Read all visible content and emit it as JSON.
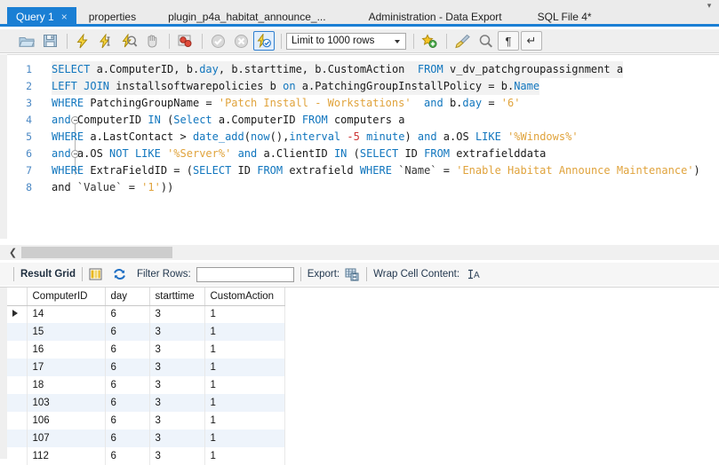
{
  "window": {
    "app": "MySQL Workbench SQL Editor"
  },
  "tabs": {
    "items": [
      {
        "label": "Query 1",
        "active": true,
        "closable": true
      },
      {
        "label": "properties",
        "active": false,
        "closable": false
      },
      {
        "label": "plugin_p4a_habitat_announce_...",
        "active": false,
        "closable": false
      },
      {
        "label": "Administration - Data Export",
        "active": false,
        "closable": false
      },
      {
        "label": "SQL File 4*",
        "active": false,
        "closable": false
      }
    ],
    "close_glyph": "×",
    "overflow_glyph": "▾",
    "accent_color": "#1a7fd4"
  },
  "toolbar": {
    "buttons": [
      {
        "name": "open-sql-script-icon",
        "glyph": "folder"
      },
      {
        "name": "save-sql-script-icon",
        "glyph": "floppy"
      },
      {
        "name": "execute-statement-icon",
        "glyph": "bolt"
      },
      {
        "name": "execute-current-statement-icon",
        "glyph": "bolt-cursor"
      },
      {
        "name": "explain-statement-icon",
        "glyph": "bolt-magnifier"
      },
      {
        "name": "stop-script-icon",
        "glyph": "hand"
      },
      {
        "name": "toggle-stop-on-error-icon",
        "glyph": "stop-error"
      },
      {
        "name": "commit-icon",
        "glyph": "check"
      },
      {
        "name": "rollback-icon",
        "glyph": "cross"
      },
      {
        "name": "autocommit-icon",
        "glyph": "bolt-check"
      }
    ],
    "limit_label": "Limit to 1000 rows",
    "right_buttons": [
      {
        "name": "add-snippet-icon",
        "glyph": "star-plus"
      },
      {
        "name": "beautify-query-icon",
        "glyph": "broom"
      },
      {
        "name": "find-icon",
        "glyph": "magnifier"
      },
      {
        "name": "toggle-invisible-chars-icon",
        "glyph": "¶"
      },
      {
        "name": "toggle-word-wrap-icon",
        "glyph": "↵"
      }
    ]
  },
  "editor": {
    "lines": [
      {
        "number": "1",
        "highlight": true,
        "fold": "none",
        "tokens": [
          {
            "t": "SELECT",
            "c": "kw"
          },
          {
            "t": " a.ComputerID, b.",
            "c": ""
          },
          {
            "t": "day",
            "c": "kw"
          },
          {
            "t": ", b.starttime, b.CustomAction  ",
            "c": ""
          },
          {
            "t": "FROM",
            "c": "kw"
          },
          {
            "t": " v_dv_patchgroupassignment a",
            "c": ""
          }
        ]
      },
      {
        "number": "2",
        "highlight": true,
        "fold": "none",
        "tokens": [
          {
            "t": "LEFT JOIN",
            "c": "kw"
          },
          {
            "t": " installsoftwarepolicies b ",
            "c": ""
          },
          {
            "t": "on",
            "c": "kw"
          },
          {
            "t": " a.PatchingGroupInstallPolicy = b.",
            "c": ""
          },
          {
            "t": "Name",
            "c": "kw"
          }
        ]
      },
      {
        "number": "3",
        "highlight": false,
        "fold": "none",
        "tokens": [
          {
            "t": "WHERE",
            "c": "kw"
          },
          {
            "t": " PatchingGroupName = ",
            "c": ""
          },
          {
            "t": "'Patch Install - Workstations'",
            "c": "str"
          },
          {
            "t": "  ",
            "c": ""
          },
          {
            "t": "and",
            "c": "kw"
          },
          {
            "t": " b.",
            "c": ""
          },
          {
            "t": "day",
            "c": "kw"
          },
          {
            "t": " = ",
            "c": ""
          },
          {
            "t": "'6'",
            "c": "str"
          }
        ]
      },
      {
        "number": "4",
        "highlight": false,
        "fold": "start",
        "tokens": [
          {
            "t": "and",
            "c": "kw"
          },
          {
            "t": " ComputerID ",
            "c": ""
          },
          {
            "t": "IN",
            "c": "kw"
          },
          {
            "t": " (",
            "c": ""
          },
          {
            "t": "Select",
            "c": "kw"
          },
          {
            "t": " a.ComputerID ",
            "c": ""
          },
          {
            "t": "FROM",
            "c": "kw"
          },
          {
            "t": " computers a",
            "c": ""
          }
        ]
      },
      {
        "number": "5",
        "highlight": false,
        "fold": "mid",
        "tokens": [
          {
            "t": "WHERE",
            "c": "kw"
          },
          {
            "t": " a.LastContact > ",
            "c": ""
          },
          {
            "t": "date_add",
            "c": "fn"
          },
          {
            "t": "(",
            "c": ""
          },
          {
            "t": "now",
            "c": "fn"
          },
          {
            "t": "(),",
            "c": ""
          },
          {
            "t": "interval",
            "c": "kw"
          },
          {
            "t": " ",
            "c": ""
          },
          {
            "t": "-5",
            "c": "num"
          },
          {
            "t": " ",
            "c": ""
          },
          {
            "t": "minute",
            "c": "kw"
          },
          {
            "t": ") ",
            "c": ""
          },
          {
            "t": "and",
            "c": "kw"
          },
          {
            "t": " a.OS ",
            "c": ""
          },
          {
            "t": "LIKE",
            "c": "kw"
          },
          {
            "t": " ",
            "c": ""
          },
          {
            "t": "'%Windows%'",
            "c": "str"
          }
        ]
      },
      {
        "number": "6",
        "highlight": false,
        "fold": "start",
        "tokens": [
          {
            "t": "and",
            "c": "kw"
          },
          {
            "t": " a.OS ",
            "c": ""
          },
          {
            "t": "NOT LIKE",
            "c": "kw"
          },
          {
            "t": " ",
            "c": ""
          },
          {
            "t": "'%Server%'",
            "c": "str"
          },
          {
            "t": " ",
            "c": ""
          },
          {
            "t": "and",
            "c": "kw"
          },
          {
            "t": " a.ClientID ",
            "c": ""
          },
          {
            "t": "IN",
            "c": "kw"
          },
          {
            "t": " (",
            "c": ""
          },
          {
            "t": "SELECT",
            "c": "kw"
          },
          {
            "t": " ID ",
            "c": ""
          },
          {
            "t": "FROM",
            "c": "kw"
          },
          {
            "t": " extrafielddata",
            "c": ""
          }
        ]
      },
      {
        "number": "7",
        "highlight": false,
        "fold": "end",
        "tokens": [
          {
            "t": "WHERE",
            "c": "kw"
          },
          {
            "t": " ExtraFieldID = (",
            "c": ""
          },
          {
            "t": "SELECT",
            "c": "kw"
          },
          {
            "t": " ID ",
            "c": ""
          },
          {
            "t": "FROM",
            "c": "kw"
          },
          {
            "t": " extrafield ",
            "c": ""
          },
          {
            "t": "WHERE",
            "c": "kw"
          },
          {
            "t": " ",
            "c": ""
          },
          {
            "t": "`Name`",
            "c": "tick"
          },
          {
            "t": " = ",
            "c": ""
          },
          {
            "t": "'Enable Habitat Announce Maintenance'",
            "c": "str"
          },
          {
            "t": ")",
            "c": ""
          }
        ]
      },
      {
        "number": "8",
        "highlight": false,
        "fold": "none",
        "tokens": [
          {
            "t": "and ",
            "c": ""
          },
          {
            "t": "`Value`",
            "c": "tick"
          },
          {
            "t": " = ",
            "c": ""
          },
          {
            "t": "'1'",
            "c": "str"
          },
          {
            "t": "))",
            "c": ""
          }
        ]
      }
    ]
  },
  "scrollbar": {
    "left_glyph": "❮"
  },
  "results_toolbar": {
    "result_grid_label": "Result Grid",
    "filter_label": "Filter Rows:",
    "filter_value": "",
    "export_label": "Export:",
    "wrap_label": "Wrap Cell Content:",
    "wrap_glyph": "↑A"
  },
  "result_grid": {
    "columns": [
      "ComputerID",
      "day",
      "starttime",
      "CustomAction"
    ],
    "rows": [
      {
        "marker": true,
        "values": [
          "14",
          "6",
          "3",
          "1"
        ]
      },
      {
        "marker": false,
        "values": [
          "15",
          "6",
          "3",
          "1"
        ]
      },
      {
        "marker": false,
        "values": [
          "16",
          "6",
          "3",
          "1"
        ]
      },
      {
        "marker": false,
        "values": [
          "17",
          "6",
          "3",
          "1"
        ]
      },
      {
        "marker": false,
        "values": [
          "18",
          "6",
          "3",
          "1"
        ]
      },
      {
        "marker": false,
        "values": [
          "103",
          "6",
          "3",
          "1"
        ]
      },
      {
        "marker": false,
        "values": [
          "106",
          "6",
          "3",
          "1"
        ]
      },
      {
        "marker": false,
        "values": [
          "107",
          "6",
          "3",
          "1"
        ]
      },
      {
        "marker": false,
        "values": [
          "112",
          "6",
          "3",
          "1"
        ]
      }
    ]
  }
}
